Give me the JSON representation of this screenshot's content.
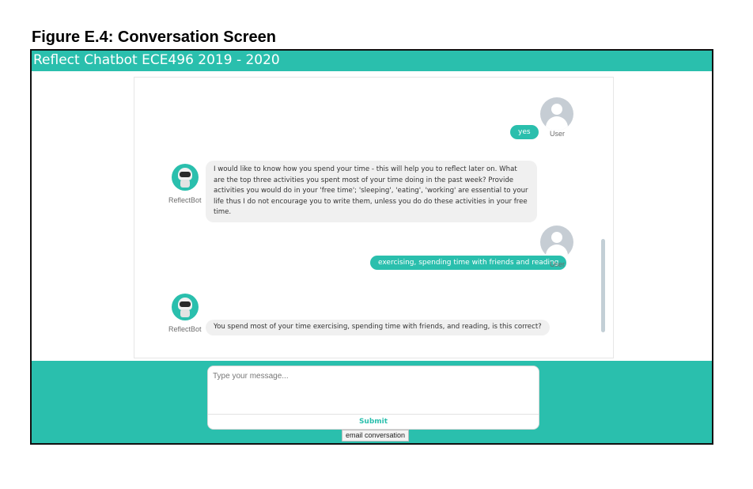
{
  "figure_caption": "Figure E.4: Conversation Screen",
  "app": {
    "title": "Reflect Chatbot ECE496 2019 - 2020"
  },
  "chat": {
    "user_name": "User",
    "bot_name": "ReflectBot",
    "messages": [
      {
        "sender": "user",
        "text": "yes"
      },
      {
        "sender": "bot",
        "text": "I would like to know how you spend your time - this will help you to reflect later on. What are the top three activities you spent most of your time doing in the past week? Provide activities you would do in your 'free time'; 'sleeping', 'eating', 'working' are essential to your life thus I do not encourage you to write them, unless you do do these activities in your free time."
      },
      {
        "sender": "user",
        "text": "exercising, spending time with friends and reading"
      },
      {
        "sender": "bot",
        "text": "You spend most of your time exercising, spending time with friends, and reading, is this correct?"
      }
    ]
  },
  "composer": {
    "placeholder": "Type your message...",
    "submit_label": "Submit"
  },
  "email_button_label": "email conversation",
  "colors": {
    "accent": "#2abfad",
    "bot_bubble": "#f0f0f0",
    "avatar_gray": "#c6cdd4"
  },
  "icons": {
    "user_avatar": "user-avatar-icon",
    "bot_avatar": "robot-avatar-icon"
  }
}
